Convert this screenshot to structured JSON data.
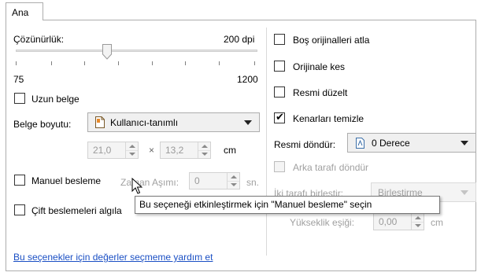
{
  "tab": {
    "label": "Ana"
  },
  "left": {
    "resolution_label": "Çözünürlük:",
    "resolution_value": "200 dpi",
    "slider_min": "75",
    "slider_max": "1200",
    "long_doc_label": "Uzun belge",
    "doc_size_label": "Belge boyutu:",
    "doc_size_value": "Kullanıcı-tanımlı",
    "width_value": "21,0",
    "times": "×",
    "height_value": "13,2",
    "unit_cm": "cm",
    "manual_feed_label": "Manuel besleme",
    "timeout_label": "Zaman Aşımı:",
    "timeout_value": "0",
    "timeout_unit": "sn.",
    "double_feed_label": "Çift beslemeleri algıla"
  },
  "right": {
    "skip_blank_label": "Boş orijinalleri atla",
    "crop_label": "Orijinale kes",
    "deskew_label": "Resmi düzelt",
    "edge_clean_label": "Kenarları temizle",
    "rotate_label": "Resmi döndür:",
    "rotate_value": "0 Derece",
    "rotate_back_label": "Arka tarafı döndür",
    "merge_label": "İki tarafı birleştir:",
    "merge_value": "Birleştirme",
    "height_threshold_label": "Yükseklik eşiği:",
    "height_threshold_value": "0,00",
    "height_threshold_unit": "cm"
  },
  "checkbox_states": {
    "long_doc": false,
    "manual_feed": false,
    "double_feed": false,
    "skip_blank": false,
    "crop": false,
    "deskew": false,
    "edge_clean": true,
    "rotate_back": false
  },
  "tooltip": "Bu seçeneği etkinleştirmek için \"Manuel besleme\" seçin",
  "help_link": "Bu seçenekler için değerler seçmeme yardım et",
  "slider_level_fraction": 0.3
}
